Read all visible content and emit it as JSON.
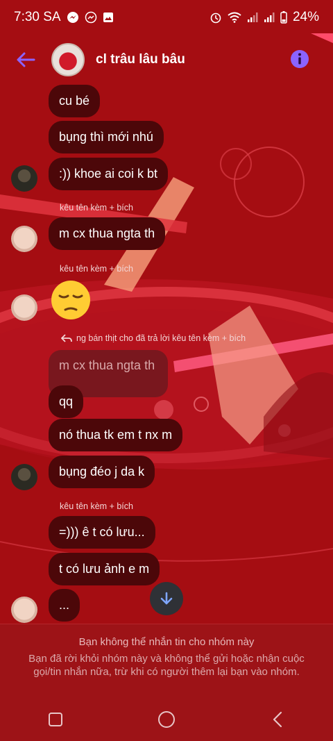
{
  "status_bar": {
    "time": "7:30 SA",
    "battery": "24%",
    "icons": [
      "messenger-icon",
      "messenger-outline-icon",
      "image-icon",
      "alarm-icon",
      "wifi-icon",
      "signal-icon",
      "signal-icon",
      "battery-icon"
    ]
  },
  "header": {
    "group_name": "cl trâu lâu bâu",
    "icons": [
      "back-arrow-icon",
      "info-icon"
    ]
  },
  "messages": [
    {
      "text": "cu bé"
    },
    {
      "text": "bụng thì mới nhú"
    },
    {
      "text": ":)) khoe ai coi k bt"
    },
    {
      "sender": "kêu tên kèm + bích",
      "text": "m cx thua ngta th"
    },
    {
      "sender": "kêu tên kèm + bích",
      "emoji": "pensive-face"
    },
    {
      "reply_note": "ng bán thịt cho đã trả lời kêu tên kèm + bích",
      "quoted": "m cx thua ngta th",
      "text": "qq"
    },
    {
      "text": "nó thua tk em t nx m"
    },
    {
      "text": "bụng đéo j da k"
    },
    {
      "sender": "kêu tên kèm + bích",
      "text": "=))) ê t có lưu..."
    },
    {
      "text": "t có lưu ảnh e m"
    },
    {
      "text": "..."
    }
  ],
  "footer": {
    "title": "Bạn không thể nhắn tin cho nhóm này",
    "body": "Bạn đã rời khỏi nhóm này và không thể gửi hoặc nhận cuộc gọi/tin nhắn nữa, trừ khi có người thêm lại bạn vào nhóm."
  },
  "nav": [
    "recents-icon",
    "home-icon",
    "back-icon"
  ],
  "colors": {
    "background": "#a50d12",
    "bubble": "#4c0709",
    "accent": "#8b63ff",
    "footer": "#9d1317"
  }
}
